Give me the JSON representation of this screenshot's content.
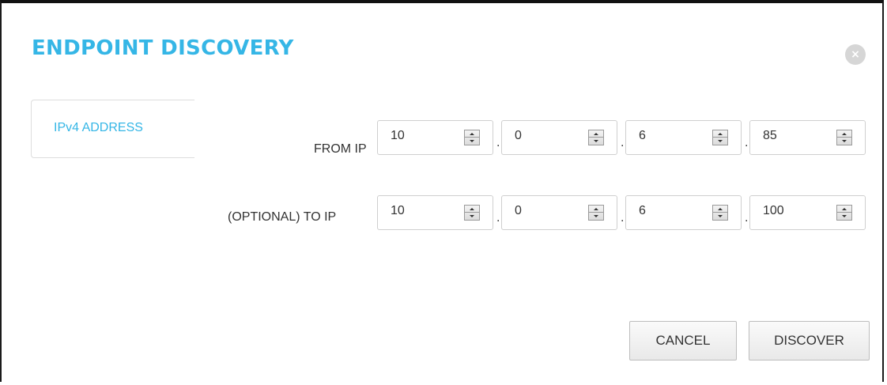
{
  "dialog": {
    "title": "ENDPOINT DISCOVERY",
    "close_label": "×"
  },
  "tabs": [
    {
      "label": "IPv4 ADDRESS",
      "active": true
    }
  ],
  "from_ip": {
    "label": "FROM IP",
    "octets": [
      "10",
      "0",
      "6",
      "85"
    ]
  },
  "to_ip": {
    "label": "(OPTIONAL) TO IP",
    "octets": [
      "10",
      "0",
      "6",
      "100"
    ]
  },
  "separator": ".",
  "buttons": {
    "cancel": "CANCEL",
    "discover": "DISCOVER"
  },
  "colors": {
    "accent": "#35b6e6",
    "text": "#333333",
    "border": "#cfcfcf"
  },
  "icons": {
    "close": "close-icon",
    "spinner": "spinner-arrows-icon"
  }
}
